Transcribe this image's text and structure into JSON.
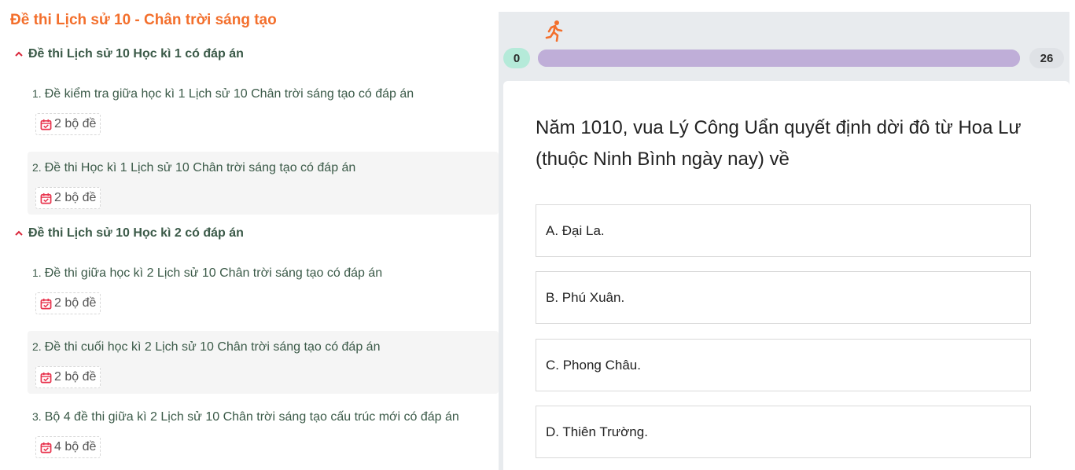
{
  "sidebar": {
    "title": "Đề thi Lịch sử 10 - Chân trời sáng tạo",
    "sections": [
      {
        "heading": "Đề thi Lịch sử 10 Học kì 1 có đáp án",
        "items": [
          {
            "num": "1.",
            "title": "Đề kiểm tra giữa học kì 1 Lịch sử 10 Chân trời sáng tạo có đáp án",
            "badge": "2 bộ đề"
          },
          {
            "num": "2.",
            "title": "Đề thi Học kì 1 Lịch sử 10 Chân trời sáng tạo có đáp án",
            "badge": "2 bộ đề"
          }
        ]
      },
      {
        "heading": "Đề thi Lịch sử 10 Học kì 2 có đáp án",
        "items": [
          {
            "num": "1.",
            "title": "Đề thi giữa học kì 2 Lịch sử 10 Chân trời sáng tạo có đáp án",
            "badge": "2 bộ đề"
          },
          {
            "num": "2.",
            "title": "Đề thi cuối học kì 2 Lịch sử 10 Chân trời sáng tạo có đáp án",
            "badge": "2 bộ đề"
          },
          {
            "num": "3.",
            "title": "Bộ 4 đề thi giữa kì 2 Lịch sử 10 Chân trời sáng tạo cấu trúc mới có đáp án",
            "badge": "4 bộ đề"
          }
        ]
      }
    ]
  },
  "quiz": {
    "icon": "runner-icon",
    "progress": {
      "current": "0",
      "total": "26",
      "fraction": 1.0
    },
    "question": "Năm 1010, vua Lý Công Uẩn quyết định dời đô từ Hoa Lư (thuộc Ninh Bình ngày nay) về",
    "options": [
      "A. Đại La.",
      "B. Phú Xuân.",
      "C. Phong Châu.",
      "D. Thiên Trường."
    ]
  },
  "colors": {
    "title": "#f36f2c",
    "text": "#3b5a48",
    "progress": "#bfaed8",
    "start_pill": "#b5ead9",
    "icon_red": "#e8344e"
  }
}
